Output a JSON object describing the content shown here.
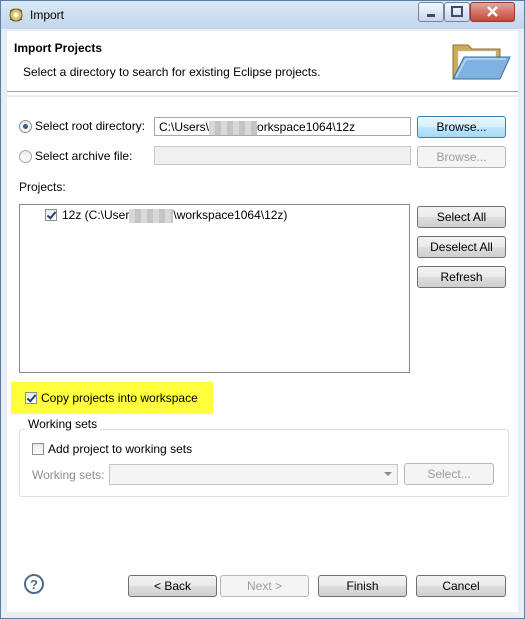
{
  "window": {
    "title": "Import",
    "icon": "eclipse-import-icon"
  },
  "header": {
    "title": "Import Projects",
    "message": "Select a directory to search for existing Eclipse projects."
  },
  "root_directory": {
    "label": "Select root directory:",
    "selected": true,
    "value_prefix": "C:\\Users\\",
    "value_suffix": "orkspace1064\\12z",
    "browse_label": "Browse..."
  },
  "archive_file": {
    "label": "Select archive file:",
    "selected": false,
    "value": "",
    "browse_label": "Browse..."
  },
  "projects": {
    "label": "Projects:",
    "items": [
      {
        "checked": true,
        "text_prefix": "12z (C:\\User",
        "text_suffix": "\\workspace1064\\12z)"
      }
    ],
    "select_all": "Select All",
    "deselect_all": "Deselect All",
    "refresh": "Refresh"
  },
  "copy_into_workspace": {
    "label": "Copy projects into workspace",
    "checked": true,
    "highlight_color": "#ffff3c"
  },
  "working_sets": {
    "group_title": "Working sets",
    "add_label": "Add project to working sets",
    "add_checked": false,
    "combo_label": "Working sets:",
    "combo_value": "",
    "select_label": "Select..."
  },
  "footer": {
    "help": "?",
    "back": "< Back",
    "next": "Next >",
    "finish": "Finish",
    "cancel": "Cancel"
  }
}
